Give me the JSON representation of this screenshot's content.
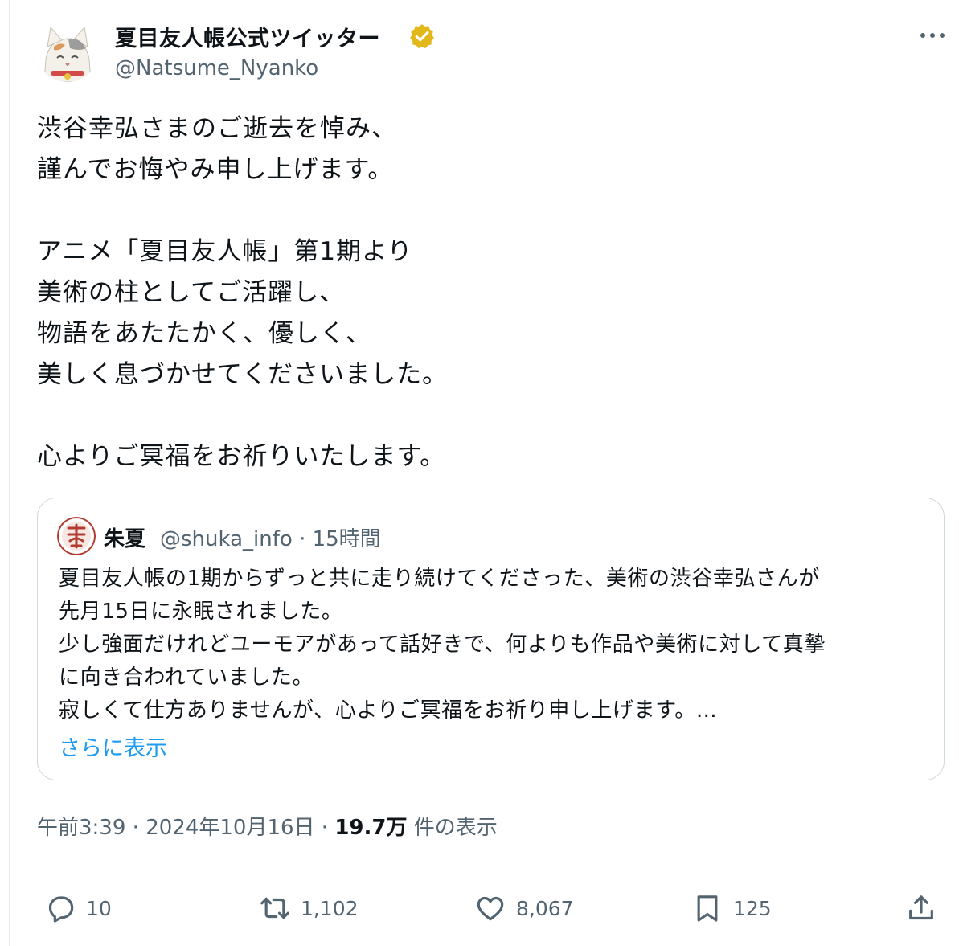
{
  "author": {
    "display_name": "夏目友人帳公式ツイッター",
    "handle": "@Natsume_Nyanko",
    "verified_color": "#e2b719"
  },
  "tweet": {
    "lines": [
      "渋谷幸弘さまのご逝去を悼み、",
      "謹んでお悔やみ申し上げます。",
      "",
      "アニメ「夏目友人帳」第1期より",
      "美術の柱としてご活躍し、",
      "物語をあたたかく、優しく、",
      "美しく息づかせてくださいました。",
      "",
      "心よりご冥福をお祈りいたします。"
    ]
  },
  "quote": {
    "name": "朱夏",
    "meta": "@shuka_info · 15時間",
    "lines": [
      "夏目友人帳の1期からずっと共に走り続けてくださった、美術の渋谷幸弘さんが",
      "先月15日に永眠されました。",
      "少し強面だけれどユーモアがあって話好きで、何よりも作品や美術に対して真摯",
      "に向き合われていました。",
      "寂しくて仕方ありませんが、心よりご冥福をお祈り申し上げます。…"
    ],
    "show_more": "さらに表示"
  },
  "meta": {
    "time": "午前3:39",
    "sep1": " · ",
    "date": "2024年10月16日",
    "sep2": " · ",
    "views": "19.7万",
    "views_label": " 件の表示"
  },
  "actions": {
    "replies": "10",
    "reposts": "1,102",
    "likes": "8,067",
    "bookmarks": "125"
  },
  "colors": {
    "text": "#0f1419",
    "secondary": "#536471",
    "link": "#1d9bf0",
    "border": "#cfd9de"
  }
}
